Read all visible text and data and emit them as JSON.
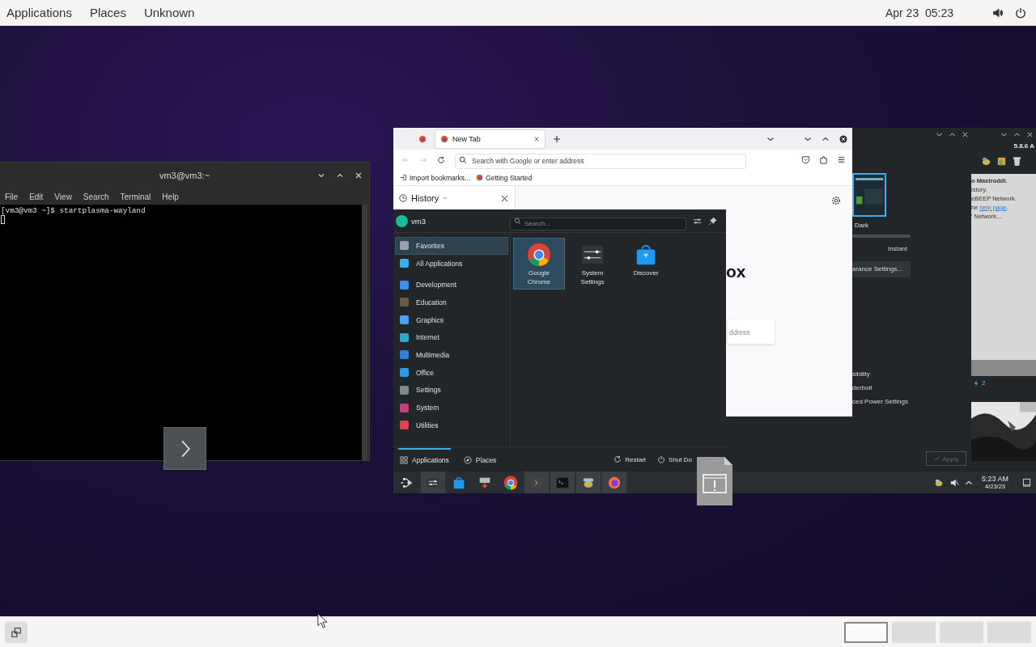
{
  "top_bar": {
    "menus": [
      "Applications",
      "Places",
      "Unknown"
    ],
    "clock": "Apr 23  05:23"
  },
  "terminal": {
    "title": "vm3@vm3:~",
    "menu": [
      "File",
      "Edit",
      "View",
      "Search",
      "Terminal",
      "Help"
    ],
    "lines": [
      "[vm3@vm3 ~]$ startplasma-wayland"
    ]
  },
  "firefox": {
    "tabs": [
      {
        "kind": "pinned",
        "selected": false
      },
      {
        "kind": "tab",
        "label": "New Tab",
        "selected": true
      }
    ],
    "address_placeholder": "Search with Google or enter address",
    "bookmarks": [
      "Import bookmarks...",
      "Getting Started"
    ],
    "sidebar_title": "History",
    "page_logo_text": "ox",
    "page_search_text": "ddress"
  },
  "launcher": {
    "user": "vm3",
    "search_placeholder": "Search...",
    "categories": [
      {
        "label": "Favorites",
        "selected": true,
        "color": "#9aa3ad"
      },
      {
        "label": "All Applications",
        "selected": false,
        "color": "#3daee9"
      },
      {
        "label": "Development",
        "selected": false,
        "color": "#3d8ee9"
      },
      {
        "label": "Education",
        "selected": false,
        "color": "#6b5a4a"
      },
      {
        "label": "Graphics",
        "selected": false,
        "color": "#4aa3f0"
      },
      {
        "label": "Internet",
        "selected": false,
        "color": "#2ea8c8"
      },
      {
        "label": "Multimedia",
        "selected": false,
        "color": "#2f7fd8"
      },
      {
        "label": "Office",
        "selected": false,
        "color": "#2f9be0"
      },
      {
        "label": "Settings",
        "selected": false,
        "color": "#7f8c8d"
      },
      {
        "label": "System",
        "selected": false,
        "color": "#c0407a"
      },
      {
        "label": "Utilities",
        "selected": false,
        "color": "#da4453"
      }
    ],
    "apps": [
      {
        "kind": "chrome",
        "label": "Google Chrome",
        "selected": true
      },
      {
        "kind": "sliders",
        "label": "System Settings",
        "selected": false
      },
      {
        "kind": "bag",
        "label": "Discover",
        "selected": false
      }
    ],
    "tabs": [
      {
        "label": "Applications",
        "selected": true
      },
      {
        "label": "Places",
        "selected": false
      }
    ],
    "actions": [
      "Restart",
      "Shut Do"
    ]
  },
  "settings_window": {
    "theme_label": "Dark",
    "speed_label": "Instant",
    "button": "arance Settings...",
    "items": [
      "sibility",
      "derbolt",
      "ced Power Settings"
    ],
    "apply": {
      "label": "Apply",
      "disabled": true
    }
  },
  "side_window": {
    "version": "5.8.6 A",
    "lines": [
      "o Mastroddi.",
      "istory.",
      "eBEEP Network."
    ],
    "help_line": {
      "before": "he ",
      "link": "help page",
      "after": "."
    },
    "last_line": "' Network...",
    "row_text": "2"
  },
  "tray": {
    "time": "5:23 AM",
    "date": "4/23/23"
  },
  "workspaces": [
    {
      "selected": true
    },
    {
      "selected": false
    },
    {
      "selected": false
    },
    {
      "selected": false
    }
  ]
}
